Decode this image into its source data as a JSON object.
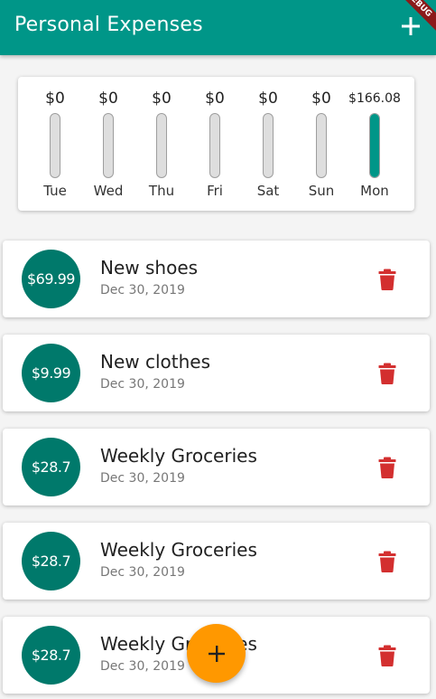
{
  "app": {
    "title": "Personal Expenses",
    "add_icon": "plus-icon",
    "debug_banner": "DEBUG"
  },
  "colors": {
    "primary": "#009688",
    "avatar": "#00796b",
    "accent": "#ff9800",
    "delete": "#d32f2f"
  },
  "chart": {
    "bars": [
      {
        "day": "Tue",
        "amount": "$0",
        "fill": 0
      },
      {
        "day": "Wed",
        "amount": "$0",
        "fill": 0
      },
      {
        "day": "Thu",
        "amount": "$0",
        "fill": 0
      },
      {
        "day": "Fri",
        "amount": "$0",
        "fill": 0
      },
      {
        "day": "Sat",
        "amount": "$0",
        "fill": 0
      },
      {
        "day": "Sun",
        "amount": "$0",
        "fill": 0
      },
      {
        "day": "Mon",
        "amount": "$166.08",
        "fill": 1
      }
    ]
  },
  "transactions": [
    {
      "amount": "$69.99",
      "title": "New shoes",
      "date": "Dec 30, 2019"
    },
    {
      "amount": "$9.99",
      "title": "New clothes",
      "date": "Dec 30, 2019"
    },
    {
      "amount": "$28.7",
      "title": "Weekly Groceries",
      "date": "Dec 30, 2019"
    },
    {
      "amount": "$28.7",
      "title": "Weekly Groceries",
      "date": "Dec 30, 2019"
    },
    {
      "amount": "$28.7",
      "title": "Weekly Groceries",
      "date": "Dec 30, 2019"
    }
  ],
  "fab": {
    "icon": "plus-icon"
  }
}
